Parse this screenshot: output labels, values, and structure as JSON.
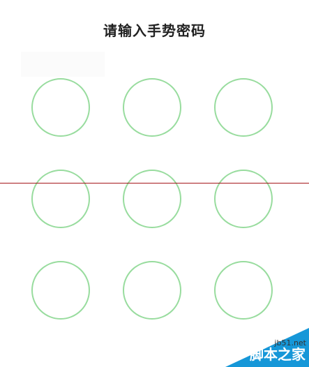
{
  "page": {
    "title": "请输入手势密码"
  },
  "gesture_pad": {
    "nodes": [
      {
        "id": "1",
        "state": "default"
      },
      {
        "id": "2",
        "state": "default"
      },
      {
        "id": "3",
        "state": "default"
      },
      {
        "id": "4",
        "state": "default"
      },
      {
        "id": "5",
        "state": "default"
      },
      {
        "id": "6",
        "state": "default"
      },
      {
        "id": "7",
        "state": "default"
      },
      {
        "id": "8",
        "state": "default"
      },
      {
        "id": "9",
        "state": "default"
      }
    ]
  },
  "watermark": {
    "site": "jb51.net",
    "brand": "脚本之家"
  },
  "colors": {
    "node_stroke": "#98dc9e",
    "accent_line": "#a4161a",
    "watermark_bg": "#1697d8"
  }
}
